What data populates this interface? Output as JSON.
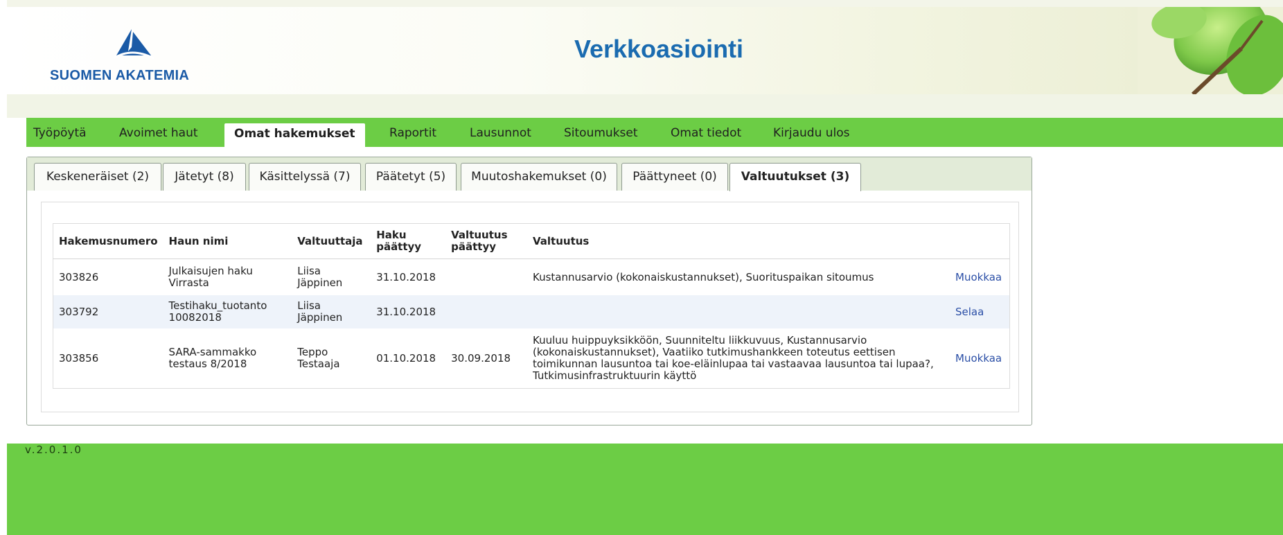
{
  "header": {
    "logo_text": "SUOMEN AKATEMIA",
    "title": "Verkkoasiointi"
  },
  "nav": {
    "items": [
      {
        "label": "Työpöytä"
      },
      {
        "label": "Avoimet haut"
      },
      {
        "label": "Omat hakemukset",
        "active": true
      },
      {
        "label": "Raportit"
      },
      {
        "label": "Lausunnot"
      },
      {
        "label": "Sitoumukset"
      },
      {
        "label": "Omat tiedot"
      },
      {
        "label": "Kirjaudu ulos"
      }
    ]
  },
  "tabs": [
    {
      "label": "Keskeneräiset (2)"
    },
    {
      "label": "Jätetyt (8)"
    },
    {
      "label": "Käsittelyssä (7)"
    },
    {
      "label": "Päätetyt (5)"
    },
    {
      "label": "Muutoshakemukset (0)"
    },
    {
      "label": "Päättyneet (0)"
    },
    {
      "label": "Valtuutukset (3)",
      "active": true
    }
  ],
  "table": {
    "headers": {
      "hakemusnumero": "Hakemusnumero",
      "haun_nimi": "Haun nimi",
      "valtuuttaja": "Valtuuttaja",
      "haku_paattyy": "Haku päättyy",
      "valtuutus_paattyy": "Valtuutus päättyy",
      "valtuutus": "Valtuutus"
    },
    "rows": [
      {
        "hakemusnumero": "303826",
        "haun_nimi": "Julkaisujen haku Virrasta",
        "valtuuttaja": "Liisa Jäppinen",
        "haku_paattyy": "31.10.2018",
        "valtuutus_paattyy": "",
        "valtuutus": "Kustannusarvio (kokonaiskustannukset), Suorituspaikan sitoumus",
        "action": "Muokkaa"
      },
      {
        "hakemusnumero": "303792",
        "haun_nimi": "Testihaku_tuotanto 10082018",
        "valtuuttaja": "Liisa Jäppinen",
        "haku_paattyy": "31.10.2018",
        "valtuutus_paattyy": "",
        "valtuutus": "",
        "action": "Selaa"
      },
      {
        "hakemusnumero": "303856",
        "haun_nimi": "SARA-sammakko testaus 8/2018",
        "valtuuttaja": "Teppo Testaaja",
        "haku_paattyy": "01.10.2018",
        "valtuutus_paattyy": "30.09.2018",
        "valtuutus": "Kuuluu huippuyksikköön, Suunniteltu liikkuvuus, Kustannusarvio (kokonaiskustannukset), Vaatiiko tutkimushankkeen toteutus eettisen toimikunnan lausuntoa tai koe-eläinlupaa tai vastaavaa lausuntoa tai lupaa?, Tutkimusinfrastruktuurin käyttö",
        "action": "Muokkaa"
      }
    ]
  },
  "footer": {
    "version": "v.2.0.1.0"
  },
  "colors": {
    "nav_green": "#6ccd45",
    "title_blue": "#1a6bb0",
    "link_blue": "#2a4ea6",
    "alt_row": "#eef3fa"
  }
}
